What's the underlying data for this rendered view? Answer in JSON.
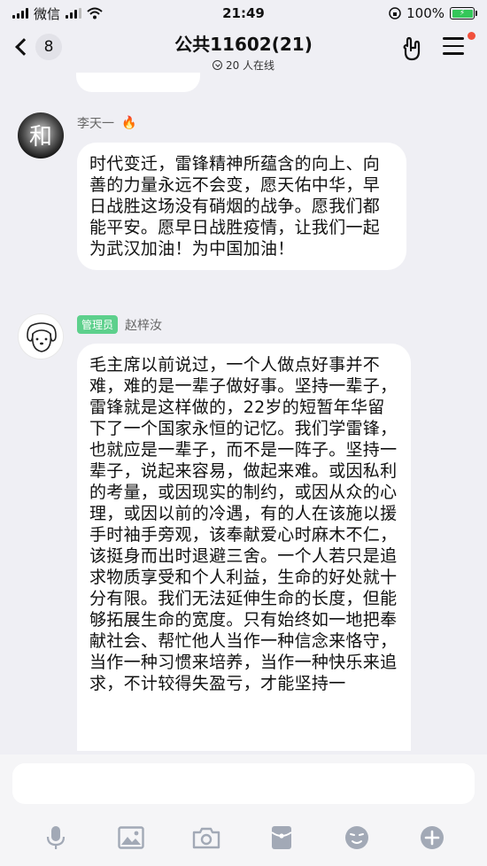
{
  "status_bar": {
    "carrier": "微信",
    "time": "21:49",
    "battery_percent": "100%"
  },
  "header": {
    "back_count": "8",
    "title": "公共11602(21)",
    "online": "20 人在线"
  },
  "messages": [
    {
      "sender": "李天一",
      "sender_emoji": "🔥",
      "text": "时代变迁，雷锋精神所蕴含的向上、向善的力量永远不会变，愿天佑中华，早日战胜这场没有硝烟的战争。愿我们都能平安。愿早日战胜疫情，让我们一起为武汉加油！为中国加油！"
    },
    {
      "badge": "管理员",
      "sender": "赵梓汝",
      "text": "毛主席以前说过，一个人做点好事并不难，难的是一辈子做好事。坚持一辈子，雷锋就是这样做的，22岁的短暂年华留下了一个国家永恒的记忆。我们学雷锋，也就应是一辈子，而不是一阵子。坚持一辈子，说起来容易，做起来难。或因私利的考量，或因现实的制约，或因从众的心理，或因以前的冷遇，有的人在该施以援手时袖手旁观，该奉献爱心时麻木不仁，该挺身而出时退避三舍。一个人若只是追求物质享受和个人利益，生命的好处就十分有限。我们无法延伸生命的长度，但能够拓展生命的宽度。只有始终如一地把奉献社会、帮忙他人当作一种信念来恪守，当作一种习惯来培养，当作一种快乐来追求，不计较得失盈亏，才能坚持一"
    }
  ],
  "toolbar": {
    "icons": [
      "microphone-icon",
      "image-icon",
      "camera-icon",
      "red-packet-icon",
      "emoji-icon",
      "plus-icon"
    ]
  },
  "colors": {
    "background": "#efeff4",
    "bubble": "#ffffff",
    "admin_badge": "#5dd08c",
    "notification_dot": "#f1503c",
    "battery": "#34c759",
    "toolbar_icon": "#a2a9b6"
  }
}
